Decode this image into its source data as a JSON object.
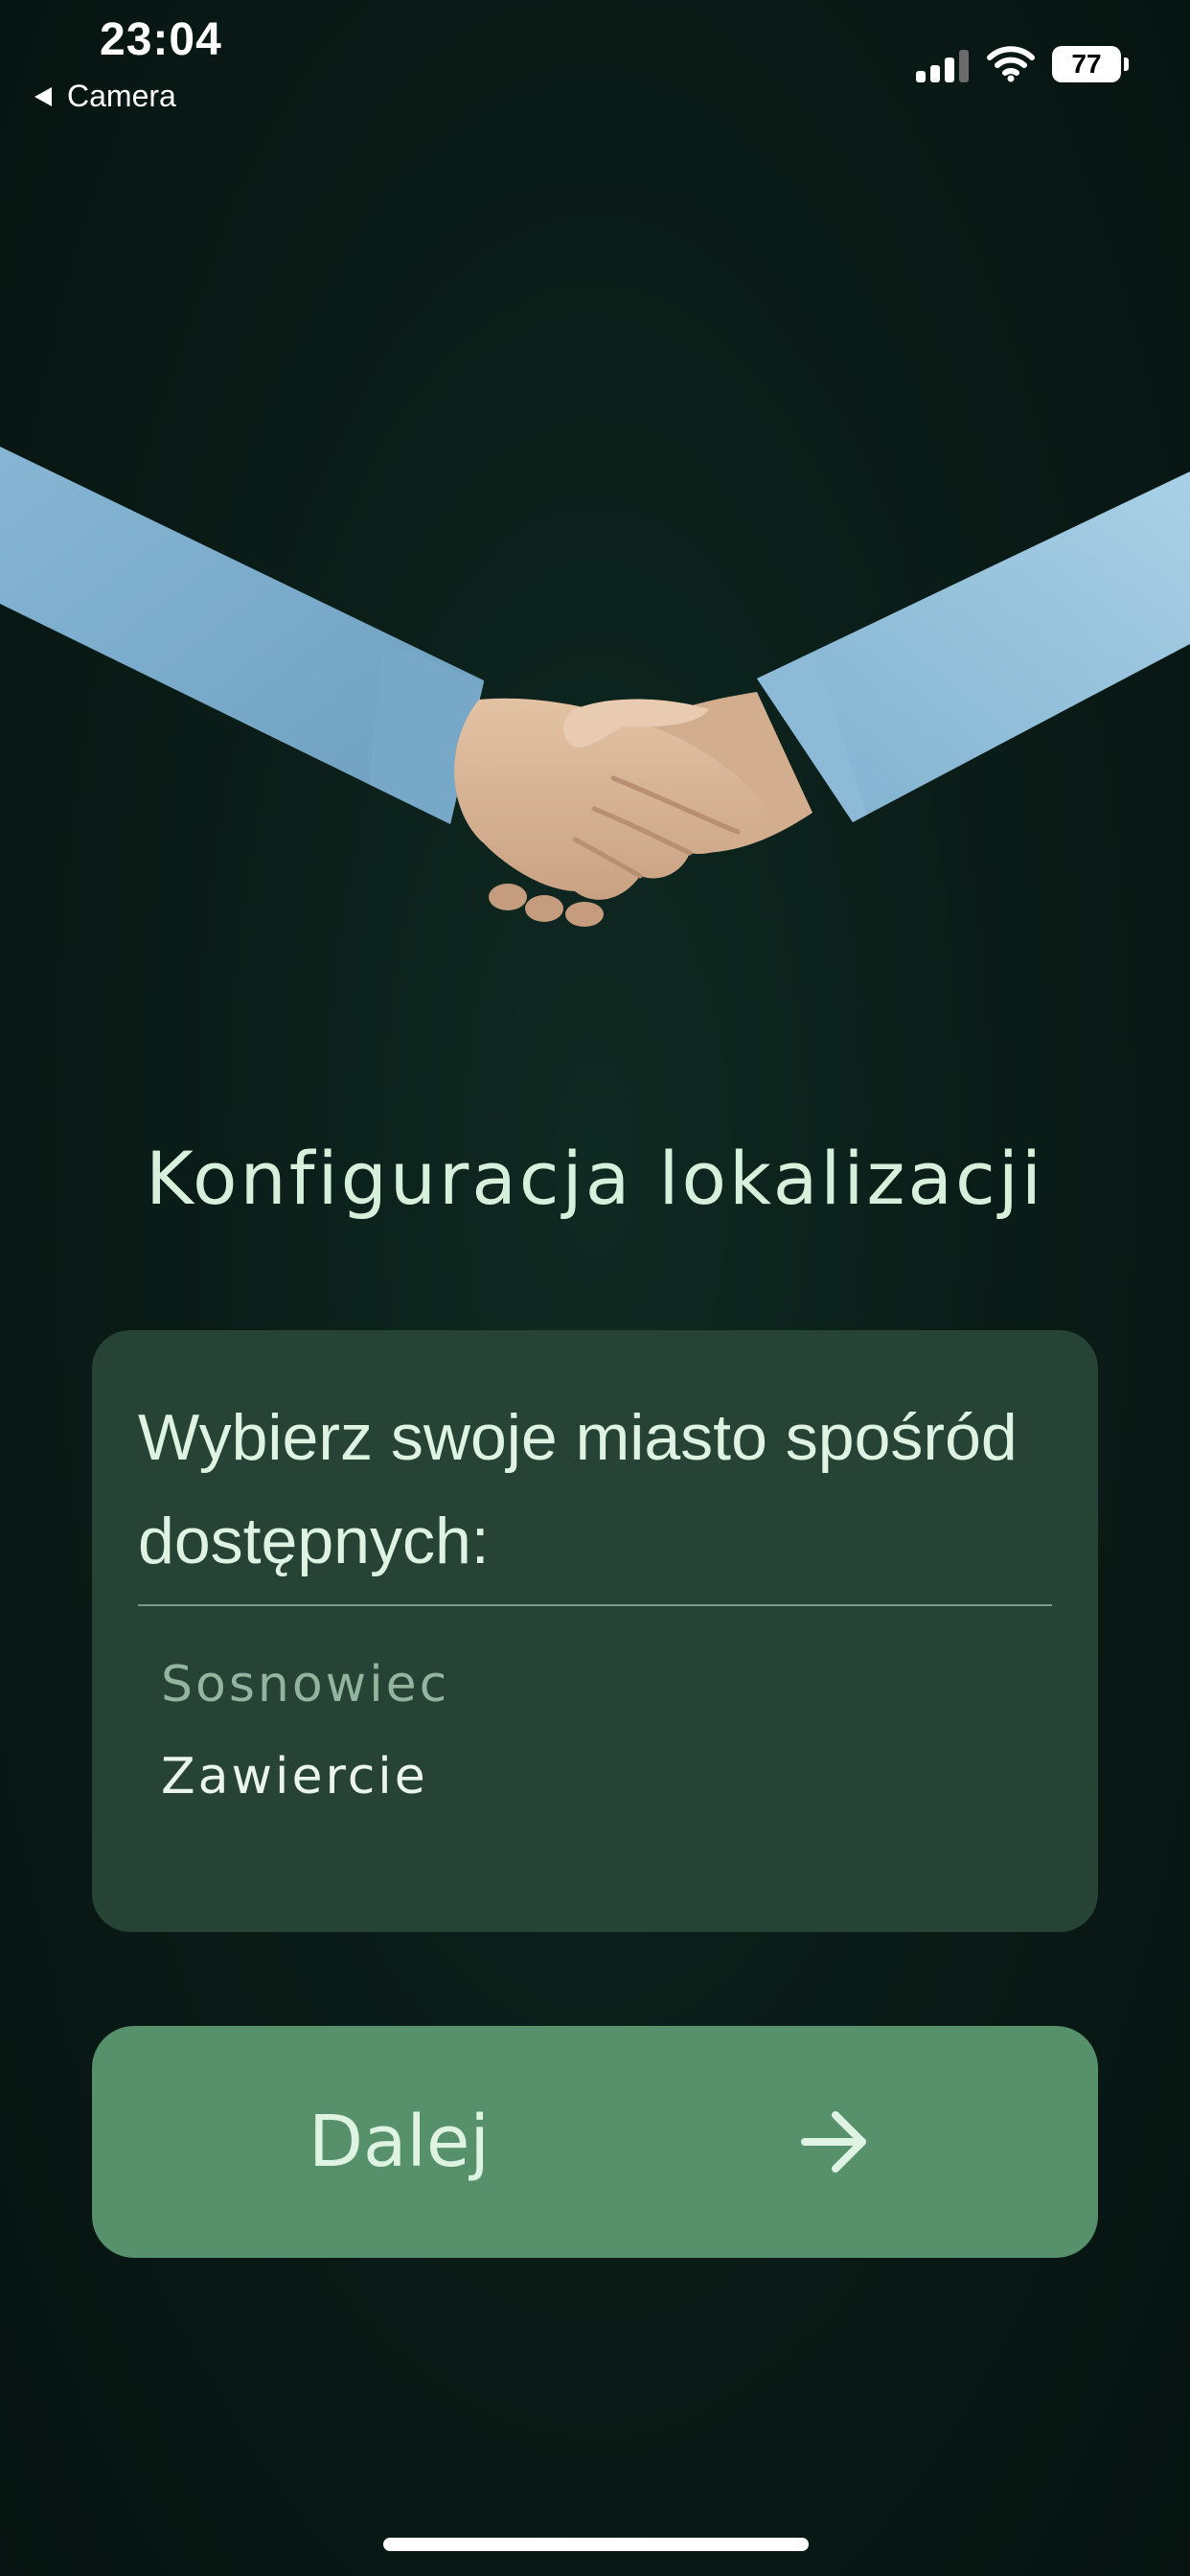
{
  "status_bar": {
    "time": "23:04",
    "back_label": "Camera",
    "battery": "77",
    "signal_icon": "cellular-signal-icon",
    "wifi_icon": "wifi-icon",
    "battery_icon": "battery-icon"
  },
  "illustration": {
    "icon": "handshake-illustration"
  },
  "page": {
    "title": "Konfiguracja lokalizacji"
  },
  "city_card": {
    "prompt": "Wybierz swoje miasto spośród dostępnych:",
    "cities": [
      {
        "label": "Sosnowiec",
        "state": "muted"
      },
      {
        "label": "Zawiercie",
        "state": "highlighted"
      }
    ]
  },
  "next_button": {
    "label": "Dalej",
    "icon": "arrow-right-icon"
  },
  "colors": {
    "background": "#0b1d18",
    "title_text": "#d6f0dc",
    "card_background": "#264335",
    "button_background": "#56916c",
    "muted_city": "#93b59f",
    "highlighted_city": "#eaf5ee"
  }
}
